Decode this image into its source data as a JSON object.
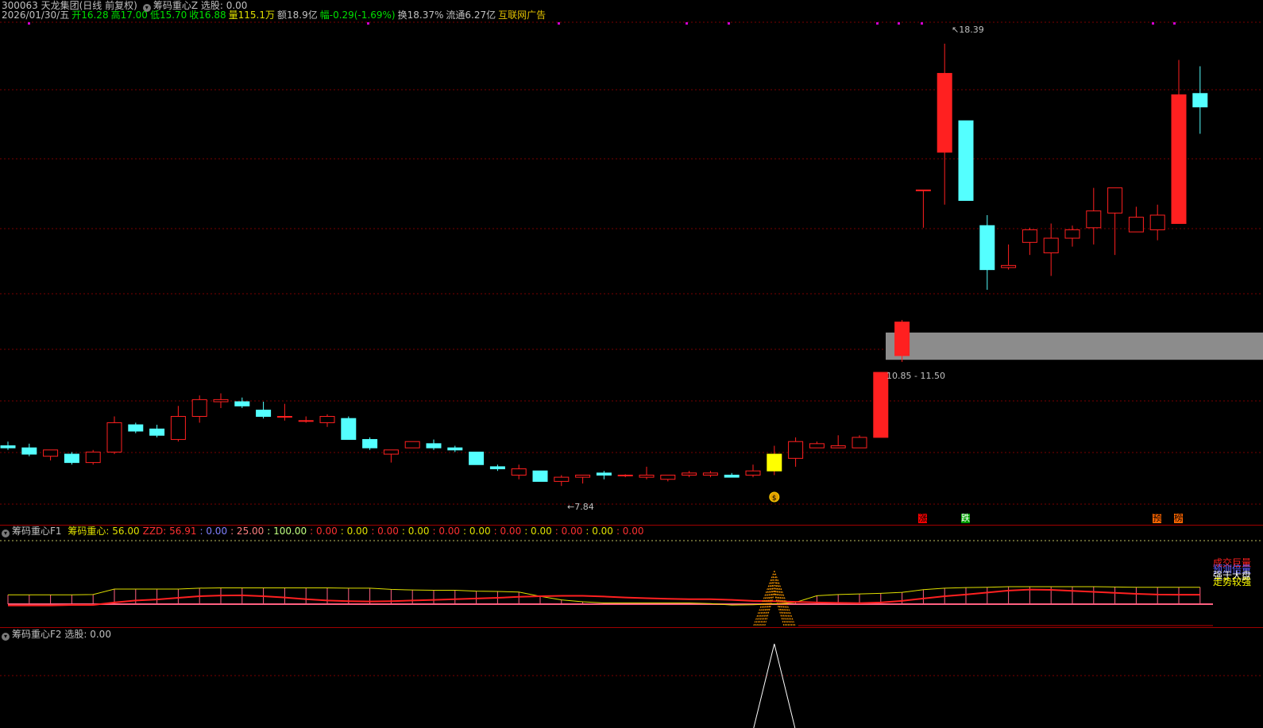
{
  "header": {
    "line1": [
      {
        "text": "300063 天龙集团(日线 前复权)",
        "color": "#c0c0c0"
      },
      {
        "text": "筹码重心Z 选股: 0.00",
        "color": "#c0c0c0",
        "icon": true
      }
    ],
    "line2": [
      {
        "text": "2026/01/30/五",
        "color": "#c0c0c0"
      },
      {
        "text": "开16.28",
        "color": "#00e000"
      },
      {
        "text": "高17.00",
        "color": "#00e000"
      },
      {
        "text": "低15.70",
        "color": "#00e000"
      },
      {
        "text": "收16.88",
        "color": "#00e000"
      },
      {
        "text": "量115.1万",
        "color": "#e0e000"
      },
      {
        "text": "额18.9亿",
        "color": "#c0c0c0"
      },
      {
        "text": "幅-0.29(-1.69%)",
        "color": "#00e000"
      },
      {
        "text": "换18.37%",
        "color": "#c0c0c0"
      },
      {
        "text": "流通6.27亿",
        "color": "#c0c0c0"
      },
      {
        "text": "互联网广告",
        "color": "#e0c000"
      }
    ]
  },
  "main_chart": {
    "high_label": "18.39",
    "low_label": "7.84",
    "zone_label": "10.85 - 11.50",
    "zone_low": 10.85,
    "zone_high": 11.5,
    "signal_marker": "$",
    "colors": {
      "up": "#ff2020",
      "down": "#54ffff",
      "signal": "#ffff00",
      "grid": "#7a0000",
      "zone": "#8c8c8c"
    },
    "price_range": [
      7.2,
      18.9
    ],
    "candles": [
      {
        "o": 8.8,
        "h": 8.9,
        "l": 8.7,
        "c": 8.75
      },
      {
        "o": 8.75,
        "h": 8.85,
        "l": 8.55,
        "c": 8.6
      },
      {
        "o": 8.55,
        "h": 8.7,
        "l": 8.45,
        "c": 8.7
      },
      {
        "o": 8.6,
        "h": 8.65,
        "l": 8.35,
        "c": 8.4
      },
      {
        "o": 8.4,
        "h": 8.7,
        "l": 8.35,
        "c": 8.65
      },
      {
        "o": 8.65,
        "h": 9.5,
        "l": 8.6,
        "c": 9.35
      },
      {
        "o": 9.3,
        "h": 9.35,
        "l": 9.1,
        "c": 9.15
      },
      {
        "o": 9.2,
        "h": 9.3,
        "l": 9.0,
        "c": 9.05
      },
      {
        "o": 8.95,
        "h": 9.75,
        "l": 8.9,
        "c": 9.5
      },
      {
        "o": 9.5,
        "h": 10.0,
        "l": 9.35,
        "c": 9.9
      },
      {
        "o": 9.85,
        "h": 10.05,
        "l": 9.7,
        "c": 9.9
      },
      {
        "o": 9.85,
        "h": 9.95,
        "l": 9.7,
        "c": 9.75
      },
      {
        "o": 9.65,
        "h": 9.85,
        "l": 9.45,
        "c": 9.5
      },
      {
        "o": 9.5,
        "h": 9.8,
        "l": 9.4,
        "c": 9.5
      },
      {
        "o": 9.4,
        "h": 9.5,
        "l": 9.35,
        "c": 9.4
      },
      {
        "o": 9.35,
        "h": 9.55,
        "l": 9.25,
        "c": 9.5
      },
      {
        "o": 9.45,
        "h": 9.5,
        "l": 8.95,
        "c": 8.95
      },
      {
        "o": 8.95,
        "h": 9.0,
        "l": 8.7,
        "c": 8.75
      },
      {
        "o": 8.6,
        "h": 8.7,
        "l": 8.4,
        "c": 8.7
      },
      {
        "o": 8.75,
        "h": 8.9,
        "l": 8.75,
        "c": 8.9
      },
      {
        "o": 8.85,
        "h": 8.95,
        "l": 8.7,
        "c": 8.75
      },
      {
        "o": 8.75,
        "h": 8.8,
        "l": 8.65,
        "c": 8.7
      },
      {
        "o": 8.65,
        "h": 8.65,
        "l": 8.35,
        "c": 8.35
      },
      {
        "o": 8.3,
        "h": 8.35,
        "l": 8.2,
        "c": 8.25
      },
      {
        "o": 8.1,
        "h": 8.35,
        "l": 8.0,
        "c": 8.25
      },
      {
        "o": 8.2,
        "h": 8.2,
        "l": 7.95,
        "c": 7.95
      },
      {
        "o": 7.95,
        "h": 8.1,
        "l": 7.84,
        "c": 8.05
      },
      {
        "o": 8.05,
        "h": 8.1,
        "l": 7.9,
        "c": 8.1
      },
      {
        "o": 8.15,
        "h": 8.2,
        "l": 8.0,
        "c": 8.1
      },
      {
        "o": 8.1,
        "h": 8.12,
        "l": 8.05,
        "c": 8.1
      },
      {
        "o": 8.05,
        "h": 8.3,
        "l": 8.0,
        "c": 8.1
      },
      {
        "o": 8.0,
        "h": 8.1,
        "l": 7.95,
        "c": 8.1
      },
      {
        "o": 8.1,
        "h": 8.2,
        "l": 8.05,
        "c": 8.15
      },
      {
        "o": 8.1,
        "h": 8.2,
        "l": 8.05,
        "c": 8.15
      },
      {
        "o": 8.1,
        "h": 8.15,
        "l": 8.05,
        "c": 8.05
      },
      {
        "o": 8.1,
        "h": 8.35,
        "l": 8.05,
        "c": 8.2
      },
      {
        "o": 8.2,
        "h": 8.8,
        "l": 8.1,
        "c": 8.6
      },
      {
        "o": 8.5,
        "h": 9.0,
        "l": 8.3,
        "c": 8.9
      },
      {
        "o": 8.75,
        "h": 8.9,
        "l": 8.75,
        "c": 8.85
      },
      {
        "o": 8.75,
        "h": 9.05,
        "l": 8.75,
        "c": 8.8
      },
      {
        "o": 8.75,
        "h": 9.05,
        "l": 8.75,
        "c": 9.0
      },
      {
        "o": 9.0,
        "h": 10.55,
        "l": 9.0,
        "c": 10.55
      },
      {
        "o": 10.95,
        "h": 11.8,
        "l": 10.8,
        "c": 11.75
      },
      {
        "o": 14.9,
        "h": 14.9,
        "l": 14.0,
        "c": 14.9
      },
      {
        "o": 15.8,
        "h": 18.39,
        "l": 14.55,
        "c": 17.68
      },
      {
        "o": 16.55,
        "h": 16.55,
        "l": 14.65,
        "c": 14.65
      },
      {
        "o": 14.05,
        "h": 14.3,
        "l": 12.52,
        "c": 13.0
      },
      {
        "o": 13.05,
        "h": 13.6,
        "l": 13.0,
        "c": 13.1
      },
      {
        "o": 13.65,
        "h": 14.0,
        "l": 13.35,
        "c": 13.95
      },
      {
        "o": 13.4,
        "h": 14.1,
        "l": 12.85,
        "c": 13.75
      },
      {
        "o": 13.75,
        "h": 14.05,
        "l": 13.55,
        "c": 13.95
      },
      {
        "o": 14.0,
        "h": 14.95,
        "l": 13.6,
        "c": 14.4
      },
      {
        "o": 14.35,
        "h": 14.5,
        "l": 13.35,
        "c": 14.95
      },
      {
        "o": 13.9,
        "h": 14.5,
        "l": 13.9,
        "c": 14.25
      },
      {
        "o": 13.95,
        "h": 14.55,
        "l": 13.7,
        "c": 14.3
      },
      {
        "o": 14.1,
        "h": 18.0,
        "l": 14.1,
        "c": 17.17
      },
      {
        "o": 17.2,
        "h": 17.85,
        "l": 16.24,
        "c": 16.88
      }
    ]
  },
  "bottom_tags": [
    {
      "text": "涨",
      "bg": "#ff0000",
      "color": "#000",
      "bar": 43
    },
    {
      "text": "跌",
      "bg": "#00a000",
      "color": "#fff",
      "bar": 45
    },
    {
      "text": "预",
      "bg": "#ff6600",
      "color": "#000",
      "bar": 54
    },
    {
      "text": "榜",
      "bg": "#ff6600",
      "color": "#000",
      "bar": 55
    }
  ],
  "panel_f1": {
    "title": "筹码重心F1",
    "values": [
      {
        "text": "筹码重心: 56.00",
        "color": "#e0e000"
      },
      {
        "text": "ZZD: 56.91",
        "color": "#ff3030"
      },
      {
        "text": ": 0.00",
        "color": "#8080ff"
      },
      {
        "text": ": 25.00",
        "color": "#ff8080"
      },
      {
        "text": ": 100.00",
        "color": "#c0ff80"
      },
      {
        "text": ": 0.00",
        "color": "#ff3030"
      },
      {
        "text": ": 0.00",
        "color": "#e0e000"
      },
      {
        "text": ": 0.00",
        "color": "#ff3030"
      },
      {
        "text": ": 0.00",
        "color": "#e0e000"
      },
      {
        "text": ": 0.00",
        "color": "#ff3030"
      },
      {
        "text": ": 0.00",
        "color": "#e0e000"
      },
      {
        "text": ": 0.00",
        "color": "#ff3030"
      },
      {
        "text": ": 0.00",
        "color": "#e0e000"
      },
      {
        "text": ": 0.00",
        "color": "#ff3030"
      },
      {
        "text": ": 0.00",
        "color": "#e0e000"
      },
      {
        "text": ": 0.00",
        "color": "#ff3030"
      }
    ],
    "legend": [
      {
        "text": "成交巨量",
        "color": "#ff2020"
      },
      {
        "text": "预测倍量",
        "color": "#6060ff"
      },
      {
        "text": "强于大盘",
        "color": "#ffffff"
      },
      {
        "text": "走势较强",
        "color": "#ffff00"
      }
    ],
    "yellow_series": [
      31,
      31,
      31,
      31,
      32,
      50,
      50,
      50,
      50,
      53,
      54,
      54,
      54,
      54,
      54,
      54,
      53,
      53,
      49,
      47,
      46,
      46,
      43,
      42,
      40,
      26,
      14,
      8,
      4,
      4,
      4,
      4,
      4,
      2,
      -3,
      -2,
      1,
      6,
      28,
      32,
      34,
      36,
      39,
      48,
      53,
      55,
      56,
      58,
      58,
      58,
      58,
      58,
      57,
      56,
      56,
      56,
      56
    ],
    "red_series": [
      -8,
      -8,
      -8,
      -5,
      -5,
      10,
      22,
      28,
      38,
      48,
      52,
      53,
      48,
      40,
      30,
      22,
      18,
      16,
      18,
      22,
      26,
      30,
      34,
      38,
      44,
      48,
      50,
      50,
      46,
      40,
      36,
      32,
      30,
      30,
      26,
      20,
      18,
      14,
      10,
      8,
      6,
      10,
      20,
      34,
      48,
      58,
      70,
      82,
      88,
      86,
      80,
      74,
      68,
      62,
      58,
      57,
      57
    ]
  },
  "panel_f2": {
    "title": "筹码重心F2",
    "value": "选股: 0.00"
  }
}
